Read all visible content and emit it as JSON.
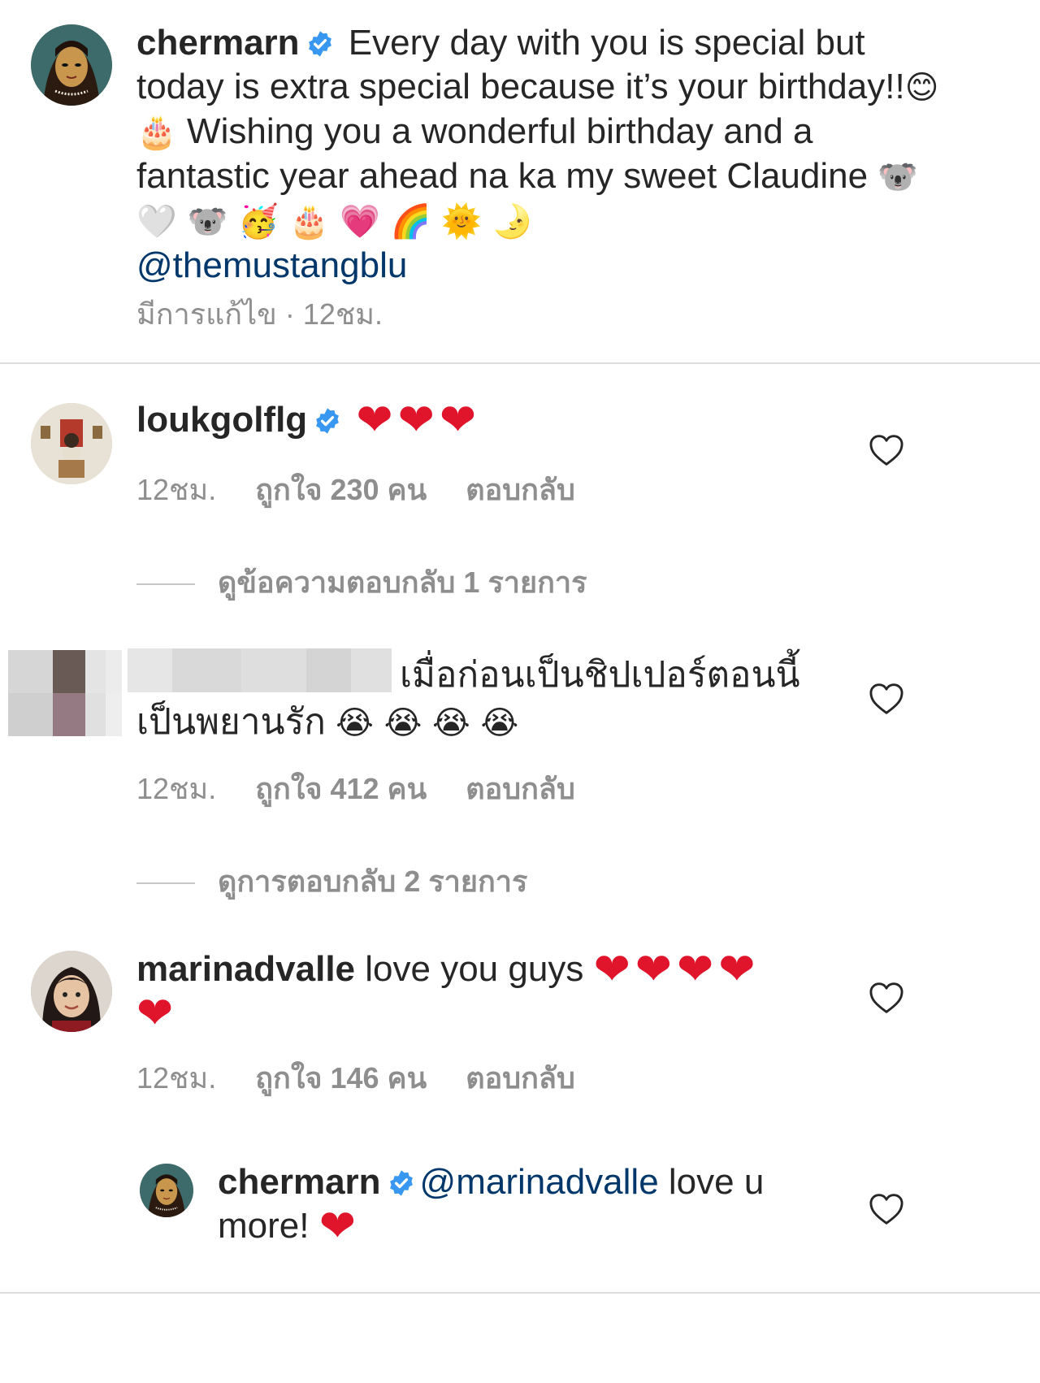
{
  "caption": {
    "username": "chermarn",
    "text_pre": "Every day with you is special but today is extra special because it’s your birthday!!",
    "emoji1": "😊 🎂",
    "text_mid": " Wishing you a wonderful birthday and a fantastic year ahead  na ka my sweet Claudine ",
    "emoji2": "🐨 🤍 🐨 🥳 🎂 💗 🌈 🌞 🌛",
    "mention": "@themustangblu",
    "edited": "มีการแก้ไข",
    "time": "12ชม."
  },
  "comments": [
    {
      "username": "loukgolflg",
      "emoji": "❤❤❤",
      "time": "12ชม.",
      "likes": "ถูกใจ 230 คน",
      "reply": "ตอบกลับ",
      "view_replies": "ดูข้อความตอบกลับ 1 รายการ"
    },
    {
      "text_line1": "เมื่อก่อนเป็นชิปเปอร์ตอนนี้",
      "text_line2": "เป็นพยานรัก",
      "emoji": "😭 😭 😭 😭",
      "time": "12ชม.",
      "likes": "ถูกใจ 412 คน",
      "reply": "ตอบกลับ",
      "view_replies": "ดูการตอบกลับ 2 รายการ"
    },
    {
      "username": "marinadvalle",
      "text": "love you guys",
      "emoji_line1": "❤❤❤❤",
      "emoji_line2": "❤",
      "time": "12ชม.",
      "likes": "ถูกใจ 146 คน",
      "reply": "ตอบกลับ"
    }
  ],
  "reply": {
    "username": "chermarn",
    "mention": "@marinadvalle",
    "text": " love u",
    "text_line2": "more!",
    "emoji": "❤"
  },
  "colors": {
    "text": "#262626",
    "meta": "#8e8e8e",
    "mention": "#00376b",
    "verified": "#3897f0",
    "heart": "#e0142b"
  },
  "icons": [
    "verified-badge-icon",
    "heart-outline-icon"
  ]
}
